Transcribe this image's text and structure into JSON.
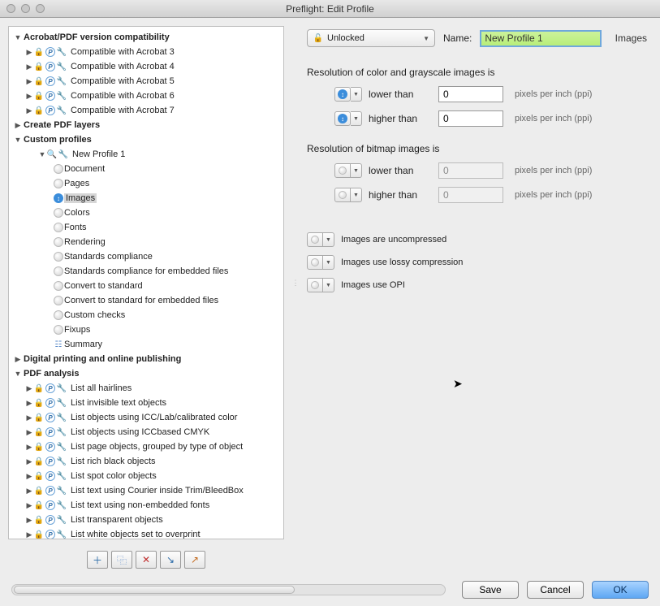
{
  "window": {
    "title": "Preflight: Edit Profile"
  },
  "tree": {
    "g0": {
      "label": "Acrobat/PDF version compatibility",
      "open": true
    },
    "g0_items": [
      {
        "label": "Compatible with Acrobat 3"
      },
      {
        "label": "Compatible with Acrobat 4"
      },
      {
        "label": "Compatible with Acrobat 5"
      },
      {
        "label": "Compatible with Acrobat 6"
      },
      {
        "label": "Compatible with Acrobat 7"
      }
    ],
    "g1": {
      "label": "Create PDF layers",
      "open": false
    },
    "g2": {
      "label": "Custom profiles",
      "open": true
    },
    "g2_profile": {
      "label": "New Profile 1",
      "open": true
    },
    "g2_children": [
      {
        "label": "Document",
        "icon": "dot"
      },
      {
        "label": "Pages",
        "icon": "dot"
      },
      {
        "label": "Images",
        "icon": "info",
        "selected": true
      },
      {
        "label": "Colors",
        "icon": "dot"
      },
      {
        "label": "Fonts",
        "icon": "dot"
      },
      {
        "label": "Rendering",
        "icon": "dot"
      },
      {
        "label": "Standards compliance",
        "icon": "dot"
      },
      {
        "label": "Standards compliance for embedded files",
        "icon": "dot"
      },
      {
        "label": "Convert to standard",
        "icon": "dot"
      },
      {
        "label": "Convert to standard for embedded files",
        "icon": "dot"
      },
      {
        "label": "Custom checks",
        "icon": "dot"
      },
      {
        "label": "Fixups",
        "icon": "dot"
      },
      {
        "label": "Summary",
        "icon": "summary"
      }
    ],
    "g3": {
      "label": "Digital printing and online publishing",
      "open": false
    },
    "g4": {
      "label": "PDF analysis",
      "open": true
    },
    "g4_items": [
      {
        "label": "List all hairlines"
      },
      {
        "label": "List invisible text objects"
      },
      {
        "label": "List objects using ICC/Lab/calibrated color"
      },
      {
        "label": "List objects using ICCbased CMYK"
      },
      {
        "label": "List page objects, grouped by type of object"
      },
      {
        "label": "List rich black objects"
      },
      {
        "label": "List spot color objects"
      },
      {
        "label": "List text using Courier inside Trim/BleedBox"
      },
      {
        "label": "List text using non-embedded fonts"
      },
      {
        "label": "List transparent objects"
      },
      {
        "label": "List white objects set to overprint"
      }
    ]
  },
  "toolbar": {
    "add": "＋",
    "dup": "⿻",
    "del": "✕",
    "import": "↘",
    "export": "↗"
  },
  "right": {
    "lock_state": "Unlocked",
    "name_label": "Name:",
    "name_value": "New Profile 1",
    "section_label": "Images",
    "head1": "Resolution of color and grayscale images is",
    "head2": "Resolution of bitmap images is",
    "lower_than": "lower than",
    "higher_than": "higher than",
    "val_lower1": "0",
    "val_higher1": "0",
    "val_lower2": "0",
    "val_higher2": "0",
    "unit": "pixels per inch (ppi)",
    "chk1": "Images are uncompressed",
    "chk2": "Images use lossy compression",
    "chk3": "Images use OPI"
  },
  "buttons": {
    "save": "Save",
    "cancel": "Cancel",
    "ok": "OK"
  }
}
